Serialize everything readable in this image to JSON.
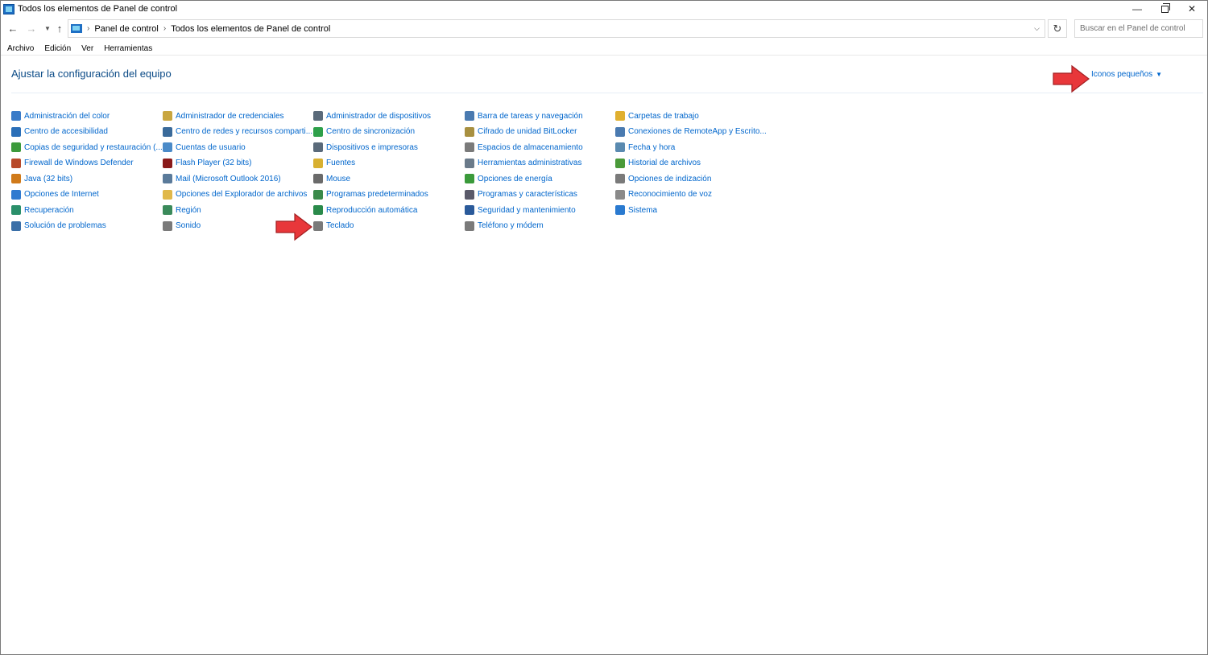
{
  "window": {
    "title": "Todos los elementos de Panel de control"
  },
  "address": {
    "crumbs": [
      "Panel de control",
      "Todos los elementos de Panel de control"
    ],
    "search_placeholder": "Buscar en el Panel de control"
  },
  "menu": [
    "Archivo",
    "Edición",
    "Ver",
    "Herramientas"
  ],
  "header": {
    "title": "Ajustar la configuración del equipo",
    "view_by": "Iconos pequeños"
  },
  "items": [
    {
      "label": "Administración del color",
      "icon": "color-management-icon",
      "color": "#3a7bc8"
    },
    {
      "label": "Centro de accesibilidad",
      "icon": "accessibility-icon",
      "color": "#2a6fb8"
    },
    {
      "label": "Copias de seguridad y restauración (...",
      "icon": "backup-icon",
      "color": "#3c9a3c"
    },
    {
      "label": "Firewall de Windows Defender",
      "icon": "firewall-icon",
      "color": "#b84a2a"
    },
    {
      "label": "Java (32 bits)",
      "icon": "java-icon",
      "color": "#d07a1a"
    },
    {
      "label": "Opciones de Internet",
      "icon": "internet-options-icon",
      "color": "#2f7ad0"
    },
    {
      "label": "Recuperación",
      "icon": "recovery-icon",
      "color": "#2a8f6a"
    },
    {
      "label": "Solución de problemas",
      "icon": "troubleshooting-icon",
      "color": "#3a6fa8"
    },
    {
      "label": "Administrador de credenciales",
      "icon": "credential-manager-icon",
      "color": "#c9a640"
    },
    {
      "label": "Centro de redes y recursos comparti...",
      "icon": "network-center-icon",
      "color": "#3a6a9a"
    },
    {
      "label": "Cuentas de usuario",
      "icon": "user-accounts-icon",
      "color": "#4a8ac8"
    },
    {
      "label": "Flash Player (32 bits)",
      "icon": "flash-player-icon",
      "color": "#8a1a1a"
    },
    {
      "label": "Mail (Microsoft Outlook 2016)",
      "icon": "mail-icon",
      "color": "#5a7a9a"
    },
    {
      "label": "Opciones del Explorador de archivos",
      "icon": "folder-options-icon",
      "color": "#e0b84a"
    },
    {
      "label": "Región",
      "icon": "region-icon",
      "color": "#3a8a5a"
    },
    {
      "label": "Sonido",
      "icon": "sound-icon",
      "color": "#7a7a7a"
    },
    {
      "label": "Administrador de dispositivos",
      "icon": "device-manager-icon",
      "color": "#5a6a7a"
    },
    {
      "label": "Centro de sincronización",
      "icon": "sync-center-icon",
      "color": "#2ea04a"
    },
    {
      "label": "Dispositivos e impresoras",
      "icon": "devices-printers-icon",
      "color": "#5a6a7a"
    },
    {
      "label": "Fuentes",
      "icon": "fonts-icon",
      "color": "#d8b030"
    },
    {
      "label": "Mouse",
      "icon": "mouse-icon",
      "color": "#6a6a6a"
    },
    {
      "label": "Programas predeterminados",
      "icon": "default-programs-icon",
      "color": "#3a8a4a"
    },
    {
      "label": "Reproducción automática",
      "icon": "autoplay-icon",
      "color": "#2a8a4a"
    },
    {
      "label": "Teclado",
      "icon": "keyboard-icon",
      "color": "#7a7a7a"
    },
    {
      "label": "Barra de tareas y navegación",
      "icon": "taskbar-icon",
      "color": "#4a7ab0"
    },
    {
      "label": "Cifrado de unidad BitLocker",
      "icon": "bitlocker-icon",
      "color": "#a89040"
    },
    {
      "label": "Espacios de almacenamiento",
      "icon": "storage-spaces-icon",
      "color": "#7a7a7a"
    },
    {
      "label": "Herramientas administrativas",
      "icon": "admin-tools-icon",
      "color": "#6a7a8a"
    },
    {
      "label": "Opciones de energía",
      "icon": "power-options-icon",
      "color": "#3a9a3a"
    },
    {
      "label": "Programas y características",
      "icon": "programs-features-icon",
      "color": "#5a5a6a"
    },
    {
      "label": "Seguridad y mantenimiento",
      "icon": "security-maintenance-icon",
      "color": "#2a5a9a"
    },
    {
      "label": "Teléfono y módem",
      "icon": "phone-modem-icon",
      "color": "#7a7a7a"
    },
    {
      "label": "Carpetas de trabajo",
      "icon": "work-folders-icon",
      "color": "#e0b030"
    },
    {
      "label": "Conexiones de RemoteApp y Escrito...",
      "icon": "remoteapp-icon",
      "color": "#4a7ab0"
    },
    {
      "label": "Fecha y hora",
      "icon": "date-time-icon",
      "color": "#5a8ab0"
    },
    {
      "label": "Historial de archivos",
      "icon": "file-history-icon",
      "color": "#4a9a3a"
    },
    {
      "label": "Opciones de indización",
      "icon": "indexing-options-icon",
      "color": "#7a7a7a"
    },
    {
      "label": "Reconocimiento de voz",
      "icon": "speech-recognition-icon",
      "color": "#8a8a8a"
    },
    {
      "label": "Sistema",
      "icon": "system-icon",
      "color": "#2a7ad0"
    }
  ],
  "colors": {
    "link": "#0066cc",
    "arrow": "#e8373a"
  }
}
